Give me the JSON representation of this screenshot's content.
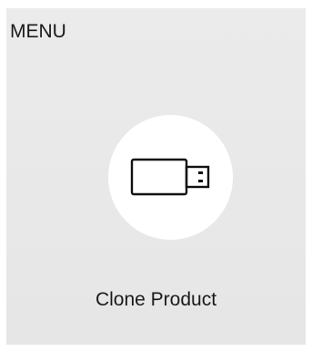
{
  "menu": {
    "title": "MENU"
  },
  "item": {
    "label": "Clone Product",
    "icon": "usb-drive-icon"
  }
}
